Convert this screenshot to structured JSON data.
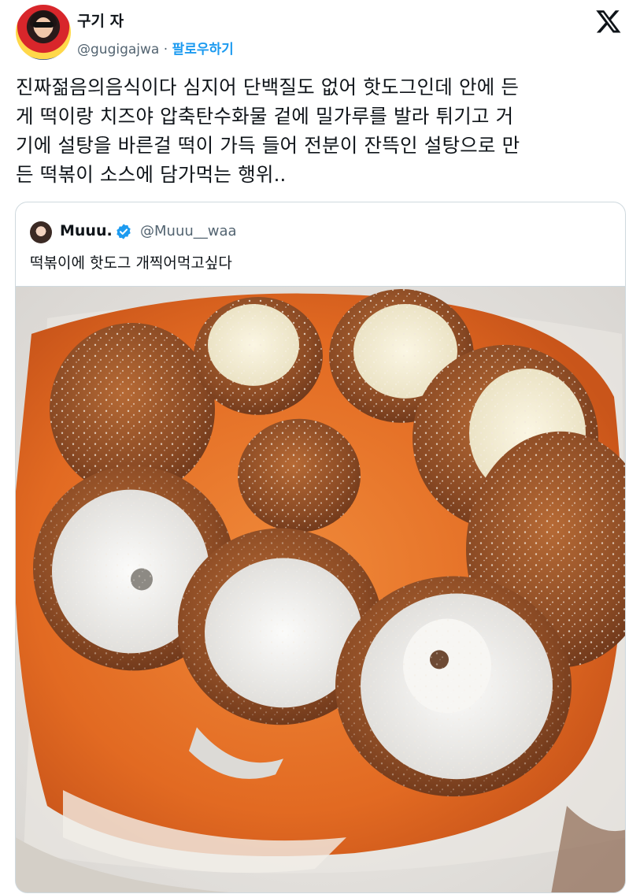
{
  "author": {
    "name": "구기 자",
    "handle": "@gugigajwa",
    "separator": "·",
    "follow_label": "팔로우하기"
  },
  "tweet": {
    "lines": [
      "진짜젊음의음식이다 심지어 단백질도 없어 핫도그인데 안에 든",
      "게 떡이랑 치즈야 압축탄수화물 겉에 밀가루를 발라 튀기고 거",
      "기에 설탕을 바른걸 떡이 가득 들어 전분이 잔뜩인 설탕으로 만",
      "든 떡볶이 소스에 담가먹는 행위.."
    ]
  },
  "quoted": {
    "name": "Muuu.",
    "handle": "@Muuu__waa",
    "text": "떡볶이에 핫도그 개찍어먹고싶다"
  },
  "icons": {
    "logo": "x-logo-icon",
    "verified": "verified-badge-icon"
  },
  "colors": {
    "accent": "#1d9bf0",
    "secondary_text": "#536471",
    "border": "#cfd9de",
    "sauce": "#e8702a",
    "crust": "#8a4a24"
  }
}
